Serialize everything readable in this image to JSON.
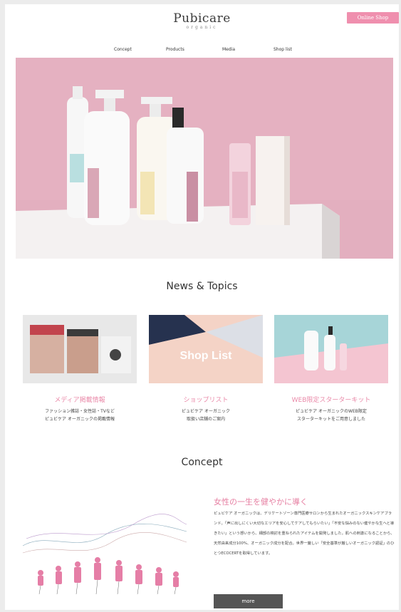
{
  "header": {
    "logo": "Pubicare",
    "logo_sub": "organic",
    "shop_button": "Online Shop",
    "nav": [
      "Concept",
      "Products",
      "Media",
      "Shop list"
    ]
  },
  "hero": {
    "slides": 3,
    "active_slide": 3
  },
  "news": {
    "title": "News & Topics",
    "cards": [
      {
        "image_text": "",
        "title": "メディア掲載情報",
        "desc_1": "ファッション雑誌・女性誌・TVなど",
        "desc_2": "ピュビケア オーガニックの掲載情報"
      },
      {
        "image_text": "Shop List",
        "title": "ショップリスト",
        "desc_1": "ピュビケア オーガニック",
        "desc_2": "取扱い店舗のご案内"
      },
      {
        "image_text": "",
        "title": "WEB限定スターターキット",
        "desc_1": "ピュビケア オーガニックのWEB限定",
        "desc_2": "スターターキットをご用意しました"
      }
    ]
  },
  "concept": {
    "title": "Concept",
    "heading": "女性の一生を健やかに導く",
    "body": "ピュビケア オーガニックは、デリケートゾーン専門医療サロンから生まれたオーガニックスキンケアブランド。「声に出しにくい大切なエリアを安心してケアしてもらいたい」「不安な悩みのない健やかな生へと導きたい」という想いから、細部の検討を重ねられたアイテムを開発しました。肌への刺激になることから、天然由来成分100%、オーガニック成分を配合。世界一厳しい「安全基準が厳しいオーガニック認証」のひとつECOCERTを取得しています。",
    "more": "more"
  },
  "colors": {
    "accent": "#ef8fae",
    "heading_pink": "#e67fa2",
    "button_dark": "#555555"
  }
}
